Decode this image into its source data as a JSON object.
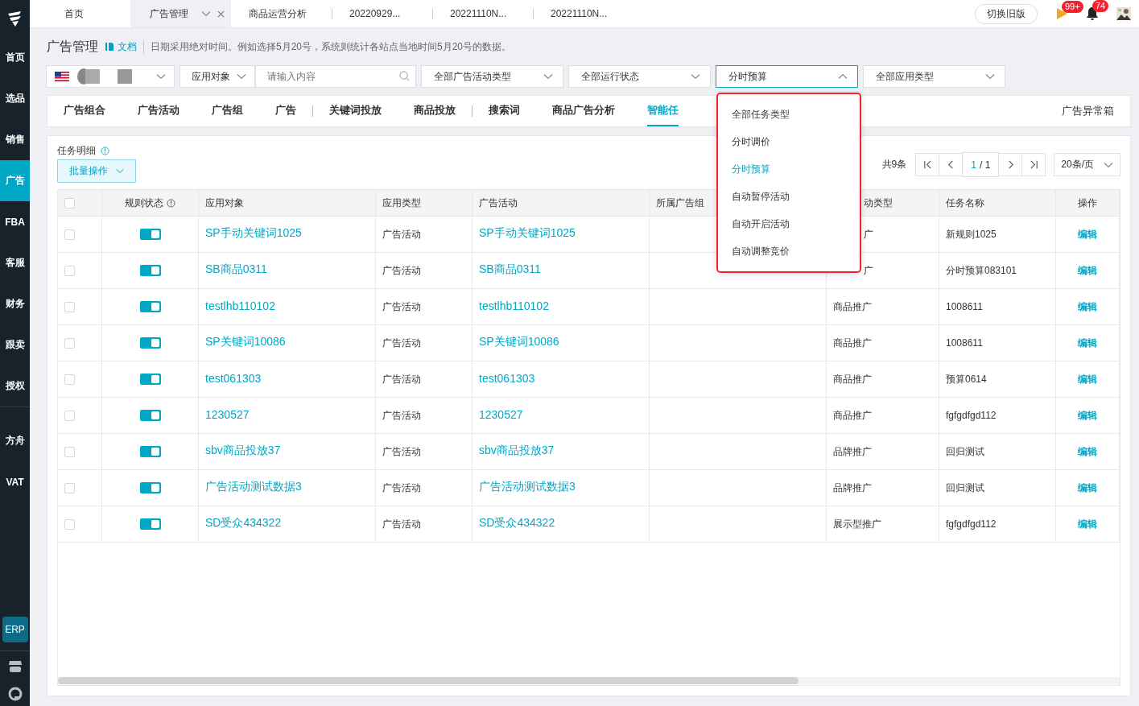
{
  "sidebar": {
    "items": [
      {
        "label": "首页",
        "selected": false
      },
      {
        "label": "选品",
        "selected": false
      },
      {
        "label": "销售",
        "selected": false
      },
      {
        "label": "广告",
        "selected": true
      },
      {
        "label": "FBA",
        "selected": false
      },
      {
        "label": "客服",
        "selected": false
      },
      {
        "label": "财务",
        "selected": false
      },
      {
        "label": "跟卖",
        "selected": false
      },
      {
        "label": "授权",
        "selected": false
      }
    ],
    "extra_items": [
      {
        "label": "方舟",
        "selected": false
      },
      {
        "label": "VAT",
        "selected": false
      }
    ],
    "erp": "ERP"
  },
  "top_tabs": [
    {
      "label": "首页",
      "selected": false,
      "closable": false
    },
    {
      "label": "广告管理",
      "selected": true,
      "closable": true
    },
    {
      "label": "商品运营分析",
      "selected": false,
      "closable": false
    },
    {
      "label": "20220929...",
      "selected": false,
      "closable": false
    },
    {
      "label": "20221110N...",
      "selected": false,
      "closable": false
    },
    {
      "label": "20221110N...",
      "selected": false,
      "closable": false
    }
  ],
  "top_right": {
    "switch_button": "切换旧版",
    "flag_badge": "99+",
    "bell_badge": "74"
  },
  "header": {
    "title": "广告管理",
    "doc_link": "文档",
    "note": "日期采用绝对时间。例如选择5月20号，系统则统计各站点当地时间5月20号的数据。"
  },
  "filters": {
    "object_select": "应用对象",
    "search": {
      "placeholder": "请输入内容"
    },
    "selects": [
      {
        "value": "全部广告活动类型",
        "expanded": false
      },
      {
        "value": "全部运行状态",
        "expanded": false
      },
      {
        "value": "分时预算",
        "expanded": true
      },
      {
        "value": "全部应用类型",
        "expanded": false
      }
    ]
  },
  "nav_tabs": {
    "items": [
      {
        "kind": "tab",
        "label": "广告组合",
        "selected": false
      },
      {
        "kind": "tab",
        "label": "广告活动",
        "selected": false
      },
      {
        "kind": "tab",
        "label": "广告组",
        "selected": false
      },
      {
        "kind": "tab",
        "label": "广告",
        "selected": false
      },
      {
        "kind": "divider"
      },
      {
        "kind": "tab",
        "label": "关键词投放",
        "selected": false
      },
      {
        "kind": "tab",
        "label": "商品投放",
        "selected": false
      },
      {
        "kind": "divider"
      },
      {
        "kind": "tab",
        "label": "搜索词",
        "selected": false
      },
      {
        "kind": "tab",
        "label": "商品广告分析",
        "selected": false
      },
      {
        "kind": "tab",
        "label": "智能任",
        "selected": true
      }
    ],
    "right_link": "广告异常箱"
  },
  "dropdown": {
    "options": [
      {
        "label": "全部任务类型",
        "selected": false
      },
      {
        "label": "分时调价",
        "selected": false
      },
      {
        "label": "分时预算",
        "selected": true
      },
      {
        "label": "自动暂停活动",
        "selected": false
      },
      {
        "label": "自动开启活动",
        "selected": false
      },
      {
        "label": "自动调整竞价",
        "selected": false
      }
    ]
  },
  "panel": {
    "title": "任务明细",
    "batch_button": "批量操作",
    "pagination": {
      "total": "共9条",
      "current": "1",
      "pages": "/ 1",
      "page_size": "20条/页"
    }
  },
  "table": {
    "header_checked": false,
    "columns": [
      {
        "label": "规则状态",
        "cut": false
      },
      {
        "label": "应用对象",
        "cut": false
      },
      {
        "label": "应用类型",
        "cut": false
      },
      {
        "label": "广告活动",
        "cut": false
      },
      {
        "label": "所属广告组",
        "cut": false
      },
      {
        "label": "动类型",
        "cut": true
      },
      {
        "label": "任务名称",
        "cut": false
      },
      {
        "label": "操作",
        "cut": false
      }
    ],
    "rows": [
      {
        "checked": false,
        "on": true,
        "target": "SP手动关键词1025",
        "apply_type": "广告活动",
        "campaign": "SP手动关键词1025",
        "campaign_type": "广",
        "campaign_type_cut": true,
        "task_name": "新规则1025",
        "action": "编辑"
      },
      {
        "checked": false,
        "on": true,
        "target": "SB商品0311",
        "apply_type": "广告活动",
        "campaign": "SB商品0311",
        "campaign_type": "广",
        "campaign_type_cut": true,
        "task_name": "分时预算083101",
        "action": "编辑"
      },
      {
        "checked": false,
        "on": true,
        "target": "testlhb110102",
        "apply_type": "广告活动",
        "campaign": "testlhb110102",
        "campaign_type": "商品推广",
        "campaign_type_cut": false,
        "task_name": "1008611",
        "action": "编辑"
      },
      {
        "checked": false,
        "on": true,
        "target": "SP关键词10086",
        "apply_type": "广告活动",
        "campaign": "SP关键词10086",
        "campaign_type": "商品推广",
        "campaign_type_cut": false,
        "task_name": "1008611",
        "action": "编辑"
      },
      {
        "checked": false,
        "on": true,
        "target": "test061303",
        "apply_type": "广告活动",
        "campaign": "test061303",
        "campaign_type": "商品推广",
        "campaign_type_cut": false,
        "task_name": "预算0614",
        "action": "编辑"
      },
      {
        "checked": false,
        "on": true,
        "target": "1230527",
        "apply_type": "广告活动",
        "campaign": "1230527",
        "campaign_type": "商品推广",
        "campaign_type_cut": false,
        "task_name": "fgfgdfgd112",
        "action": "编辑"
      },
      {
        "checked": false,
        "on": true,
        "target": "sbv商品投放37",
        "apply_type": "广告活动",
        "campaign": "sbv商品投放37",
        "campaign_type": "品牌推广",
        "campaign_type_cut": false,
        "task_name": "回归测试",
        "action": "编辑"
      },
      {
        "checked": false,
        "on": true,
        "target": "广告活动测试数据3",
        "apply_type": "广告活动",
        "campaign": "广告活动测试数据3",
        "campaign_type": "品牌推广",
        "campaign_type_cut": false,
        "task_name": "回归测试",
        "action": "编辑"
      },
      {
        "checked": false,
        "on": true,
        "target": "SD受众434322",
        "apply_type": "广告活动",
        "campaign": "SD受众434322",
        "campaign_type": "展示型推广",
        "campaign_type_cut": false,
        "task_name": "fgfgdfgd112",
        "action": "编辑"
      }
    ]
  }
}
